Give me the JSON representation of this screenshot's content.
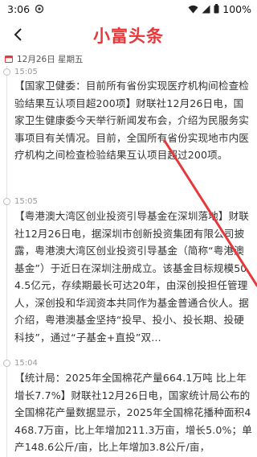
{
  "status_bar": {
    "time": "3:06",
    "battery": "100%"
  },
  "header": {
    "title": "小富头条"
  },
  "date_row": {
    "date": "12月26日 星期五"
  },
  "entries": [
    {
      "time": "15:05",
      "text": "【国家卫健委：目前所有省份实现医疗机构间检查检验结果互认项目超200项】财联社12月26日电，国家卫生健康委今天举行新闻发布会，介绍为民服务实事项目有关情况。目前，全国所有省份实现地市内医疗机构之间检查检验结果互认项目超过200项。"
    },
    {
      "time": "15:05",
      "text": "【粤港澳大湾区创业投资引导基金在深圳落地】财联社12月26日电，据深圳市创新投资集团有限公司披露，粤港澳大湾区创业投资引导基金（简称“粤港澳基金”）于近日在深圳注册成立。该基金目标规模504.5亿元，存续期最长可达20年，由深创投担任管理人，深创投和华润资本共同作为基金普通合伙人。据介绍，粤港澳基金坚持“投早、投小、投长期、投硬科技”，通过“子基金+直投”双…"
    },
    {
      "time": "15:04",
      "text": "【统计局：2025年全国棉花产量664.1万吨 比上年增长7.7%】财联社12月26日电，国家统计局公布的全国棉花产量数据显示，2025年全国棉花播种面积4468.7万亩，比上年增加211.3万亩，增长5.0%；单产148.6公斤/亩，比上年增加3.8公斤/亩，"
    }
  ]
}
